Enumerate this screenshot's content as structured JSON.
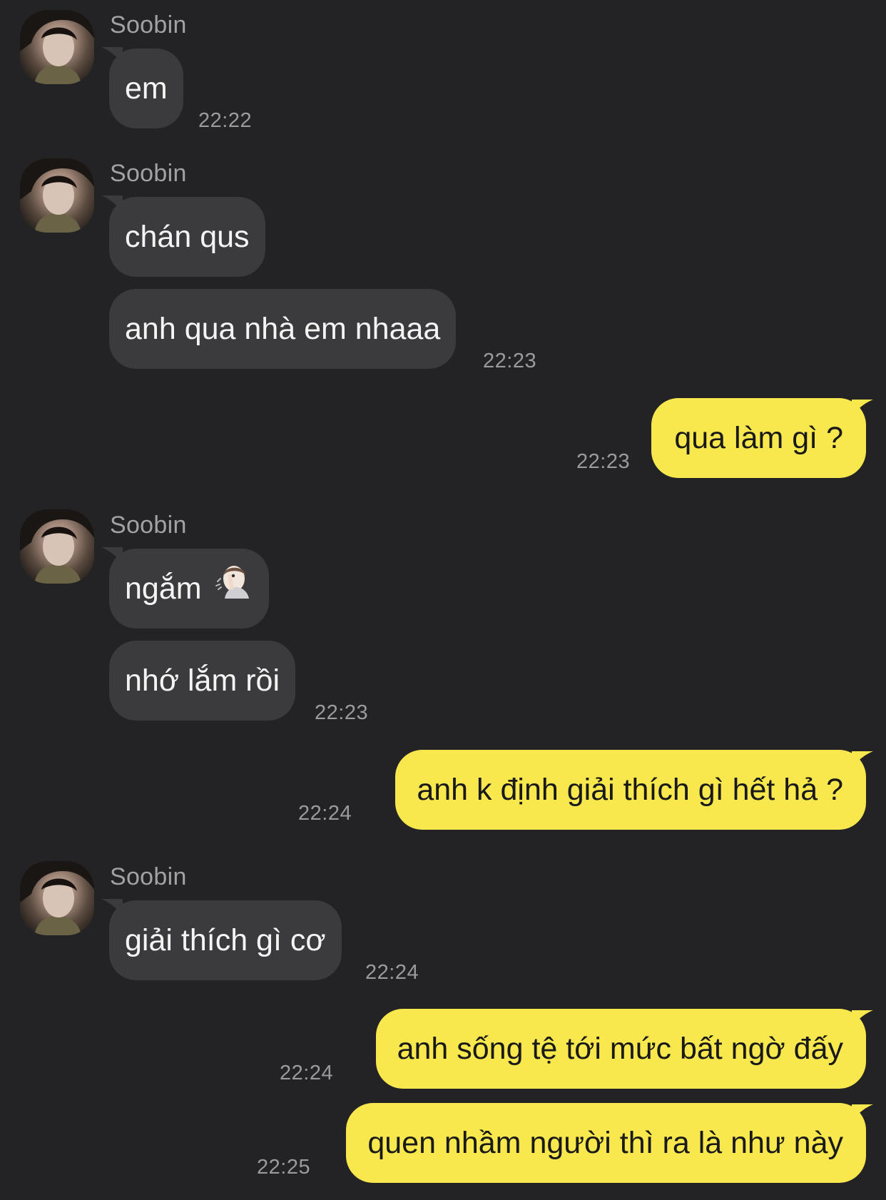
{
  "sender_name": "Soobin",
  "colors": {
    "background": "#232325",
    "incoming_bubble": "#3b3b3d",
    "outgoing_bubble": "#f8e84e",
    "timestamp": "#9b9b9f"
  },
  "messages": [
    {
      "side": "in",
      "text": "em",
      "time": "22:22"
    },
    {
      "side": "in",
      "text": "chán qus",
      "time": ""
    },
    {
      "side": "in",
      "text": "anh qua nhà em nhaaa",
      "time": "22:23"
    },
    {
      "side": "out",
      "text": "qua làm gì ?",
      "time": "22:23"
    },
    {
      "side": "in",
      "text": "ngắm",
      "icon": "person-shushing-emoji",
      "time": ""
    },
    {
      "side": "in",
      "text": "nhớ lắm rồi",
      "time": "22:23"
    },
    {
      "side": "out",
      "text": "anh k định giải thích gì hết hả ?",
      "time": "22:24"
    },
    {
      "side": "in",
      "text": "giải thích gì cơ",
      "time": "22:24"
    },
    {
      "side": "out",
      "text": "anh sống tệ tới mức bất ngờ đấy",
      "time": "22:24"
    },
    {
      "side": "out",
      "text": "quen nhầm người thì ra là như này",
      "time": "22:25"
    }
  ]
}
